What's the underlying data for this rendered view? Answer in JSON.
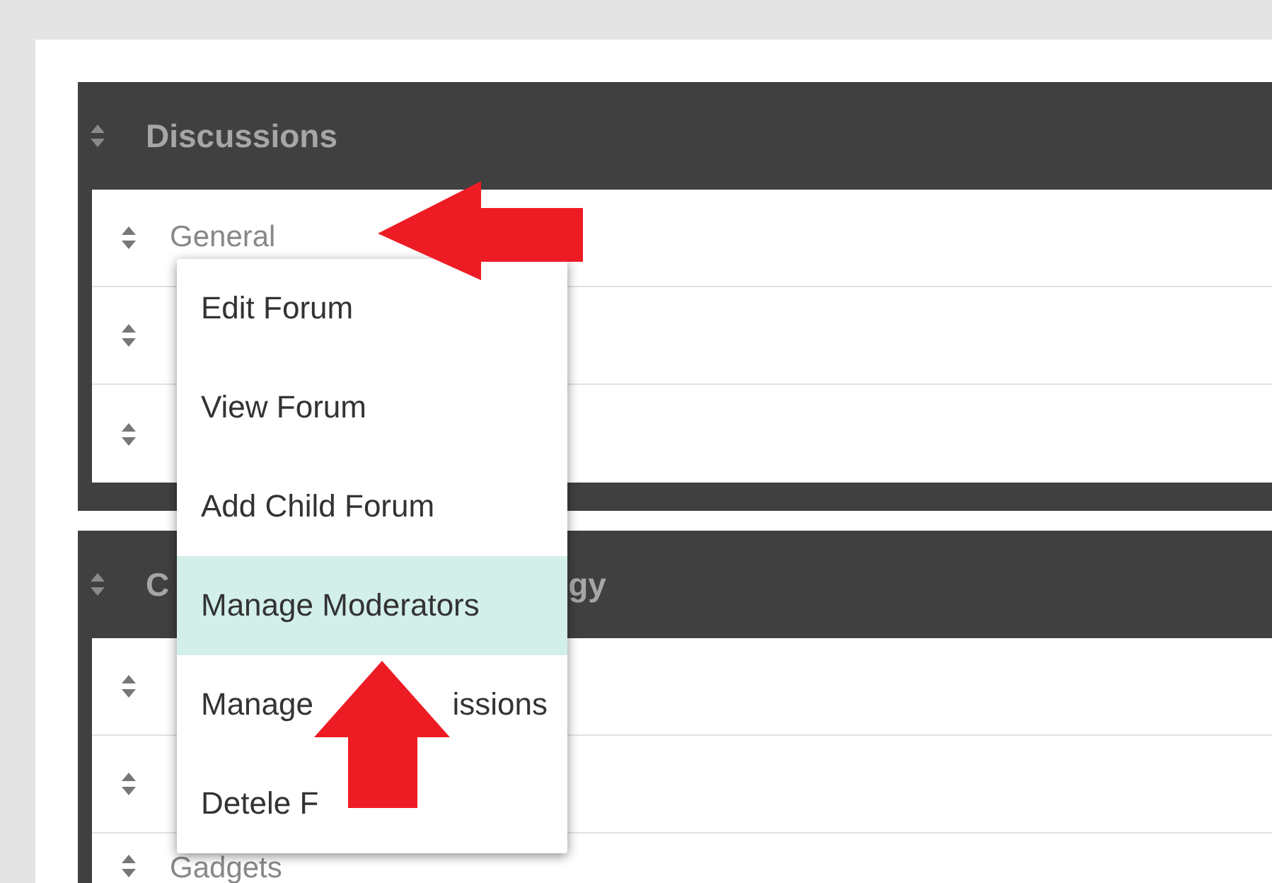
{
  "sections": [
    {
      "title_parts": [
        "Discussions"
      ],
      "rows": [
        {
          "kind": "named",
          "name": "General"
        },
        {
          "kind": "covered"
        },
        {
          "kind": "covered"
        }
      ]
    },
    {
      "title_parts": [
        "C",
        "gy"
      ],
      "rows": [
        {
          "kind": "covered"
        },
        {
          "kind": "covered"
        },
        {
          "kind": "named",
          "name": "Gadgets"
        }
      ]
    }
  ],
  "context_menu": {
    "items": [
      {
        "label": "Edit Forum",
        "selected": false
      },
      {
        "label": "View Forum",
        "selected": false
      },
      {
        "label": "Add Child Forum",
        "selected": false
      },
      {
        "label": "Manage Moderators",
        "selected": true
      },
      {
        "label_parts": [
          "Manage",
          "issions"
        ],
        "selected": false
      },
      {
        "label_parts": [
          "Detele F"
        ],
        "selected": false
      }
    ]
  },
  "annotations": [
    {
      "kind": "arrow-left"
    },
    {
      "kind": "arrow-up"
    }
  ]
}
